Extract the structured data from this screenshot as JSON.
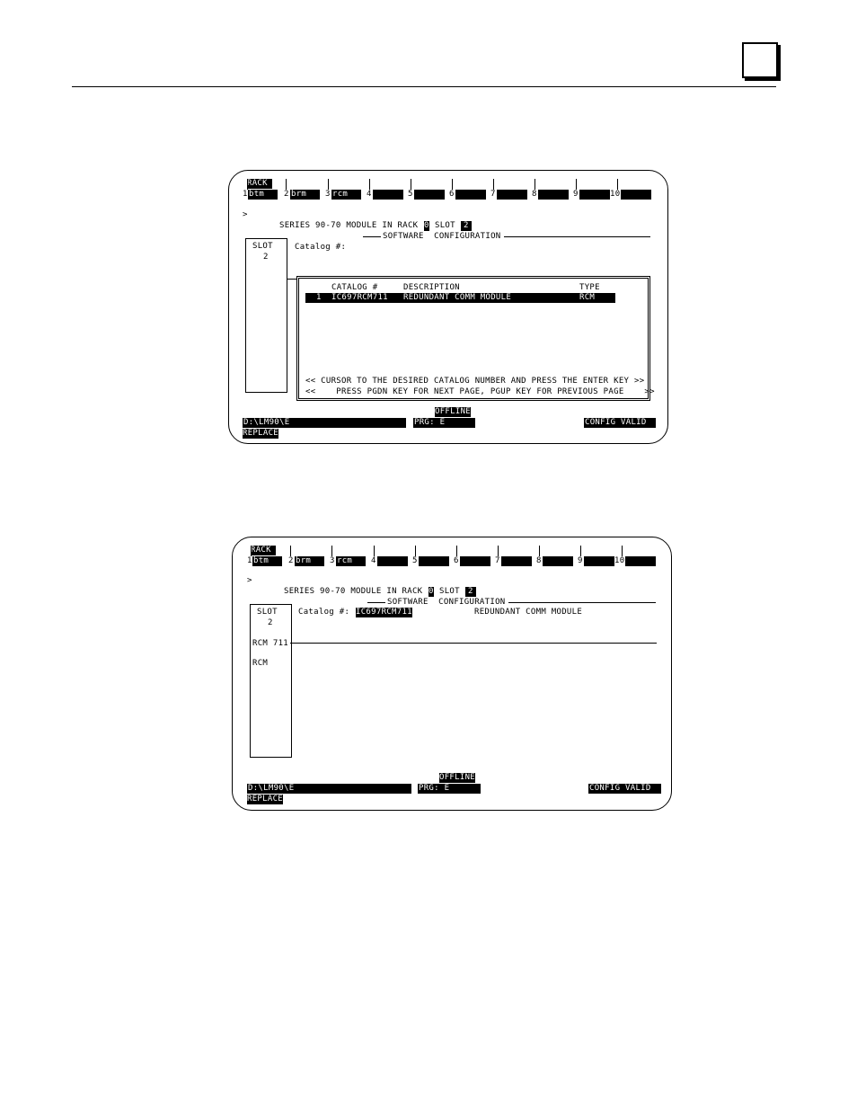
{
  "page": {
    "chapter_box": ""
  },
  "screens": [
    {
      "rack_label": "RACK",
      "function_keys": [
        {
          "num": "1",
          "label": "btm"
        },
        {
          "num": "2",
          "label": "brm"
        },
        {
          "num": "3",
          "label": "rcm"
        },
        {
          "num": "4",
          "label": ""
        },
        {
          "num": "5",
          "label": ""
        },
        {
          "num": "6",
          "label": ""
        },
        {
          "num": "7",
          "label": ""
        },
        {
          "num": "8",
          "label": ""
        },
        {
          "num": "9",
          "label": ""
        },
        {
          "num": "10",
          "label": ""
        }
      ],
      "prompt": ">",
      "series_line": "SERIES 90-70 MODULE IN RACK",
      "rack_num": "0",
      "slot_word": "SLOT",
      "slot_num": "2",
      "section_title": "SOFTWARE  CONFIGURATION",
      "slot_box": {
        "label": "SLOT",
        "num": "2"
      },
      "catalog_label": "Catalog #:",
      "catalog_value": "",
      "popup": {
        "headers": {
          "catalog": "CATALOG #",
          "description": "DESCRIPTION",
          "type": "TYPE"
        },
        "row": {
          "index": "1",
          "catalog": "IC697RCM711",
          "description": "REDUNDANT COMM MODULE",
          "type": "RCM"
        },
        "line1": "<< CURSOR TO THE DESIRED CATALOG NUMBER AND PRESS THE ENTER KEY >>",
        "line2": "<<    PRESS PGDN KEY FOR NEXT PAGE, PGUP KEY FOR PREVIOUS PAGE    >>"
      },
      "status": {
        "mode": "OFFLINE",
        "path": "D:\\LM90\\E",
        "prg": "PRG: E",
        "config": "CONFIG VALID",
        "replace": "REPLACE"
      }
    },
    {
      "rack_label": "RACK",
      "function_keys": [
        {
          "num": "1",
          "label": "btm"
        },
        {
          "num": "2",
          "label": "brm"
        },
        {
          "num": "3",
          "label": "rcm"
        },
        {
          "num": "4",
          "label": ""
        },
        {
          "num": "5",
          "label": ""
        },
        {
          "num": "6",
          "label": ""
        },
        {
          "num": "7",
          "label": ""
        },
        {
          "num": "8",
          "label": ""
        },
        {
          "num": "9",
          "label": ""
        },
        {
          "num": "10",
          "label": ""
        }
      ],
      "prompt": ">",
      "series_line": "SERIES 90-70 MODULE IN RACK",
      "rack_num": "0",
      "slot_word": "SLOT",
      "slot_num": "2",
      "section_title": "SOFTWARE  CONFIGURATION",
      "slot_box": {
        "label": "SLOT",
        "num": "2",
        "module": "RCM 711",
        "type": "RCM"
      },
      "catalog_label": "Catalog #:",
      "catalog_value": "IC697RCM711",
      "catalog_description": "REDUNDANT COMM MODULE",
      "status": {
        "mode": "OFFLINE",
        "path": "D:\\LM90\\E",
        "prg": "PRG: E",
        "config": "CONFIG VALID",
        "replace": "REPLACE"
      }
    }
  ]
}
